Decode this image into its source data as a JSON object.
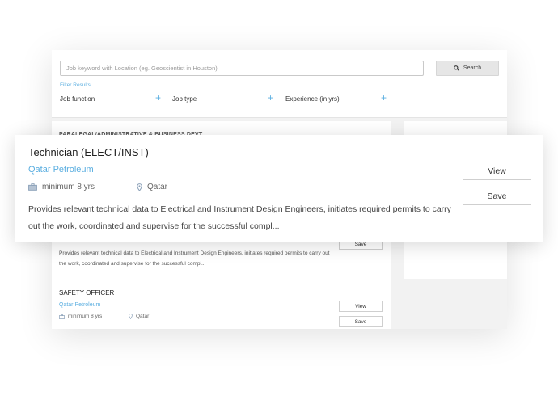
{
  "search": {
    "placeholder": "Job keyword with Location (eg. Geoscientist in Houston)",
    "button_label": "Search"
  },
  "filters": {
    "heading": "Filter Results",
    "items": [
      {
        "label": "Job function"
      },
      {
        "label": "Job type"
      },
      {
        "label": "Experience (in yrs)"
      }
    ],
    "plus": "+"
  },
  "featured_job": {
    "title": "Technician (ELECT/INST)",
    "company": "Qatar Petroleum",
    "experience": "minimum 8 yrs",
    "location": "Qatar",
    "description": "Provides relevant technical data to Electrical and Instrument Design Engineers, initiates required permits to carry out the work, coordinated and supervise for the successful compl...",
    "view_label": "View",
    "save_label": "Save"
  },
  "list": {
    "ghost_title": "PARALEGAL/ADMINISTRATIVE & BUSINESS DEVT",
    "partial_save_label": "Save",
    "partial_description": "Provides relevant technical data to Electrical and Instrument Design Engineers, initiates required permits to carry out the work, coordinated and supervise for the successful compl...",
    "second_job": {
      "title": "SAFETY OFFICER",
      "company": "Qatar Petroleum",
      "experience": "minimum 8 yrs",
      "location": "Qatar",
      "view_label": "View",
      "save_label": "Save"
    }
  },
  "colors": {
    "accent": "#5aaee0",
    "text": "#333333",
    "panel_bg": "#f2f2f2"
  }
}
